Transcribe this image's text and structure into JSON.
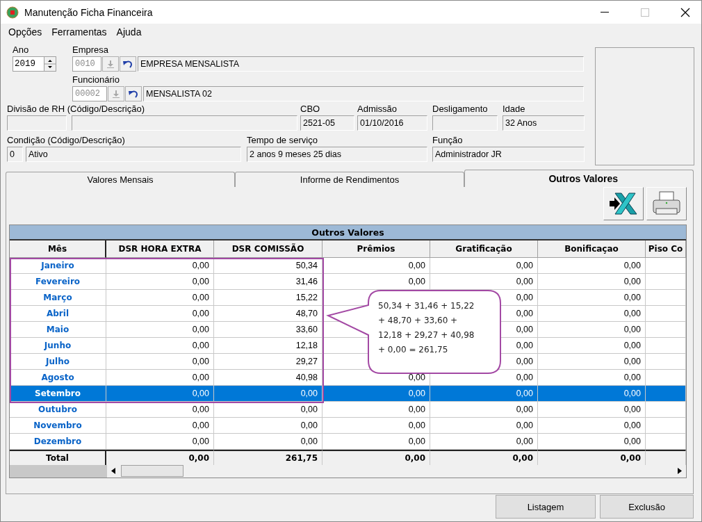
{
  "window": {
    "title": "Manutenção Ficha Financeira"
  },
  "menu": [
    "Opções",
    "Ferramentas",
    "Ajuda"
  ],
  "ano": {
    "label": "Ano",
    "value": "2019"
  },
  "empresa": {
    "label": "Empresa",
    "code": "0010",
    "name": "EMPRESA MENSALISTA"
  },
  "funcionario": {
    "label": "Funcionário",
    "code": "00002",
    "name": "MENSALISTA 02"
  },
  "divisao": {
    "label": "Divisão de RH (Código/Descrição)"
  },
  "cbo": {
    "label": "CBO",
    "value": "2521-05"
  },
  "admissao": {
    "label": "Admissão",
    "value": "01/10/2016"
  },
  "desligamento": {
    "label": "Desligamento"
  },
  "idade": {
    "label": "Idade",
    "value": "32 Anos"
  },
  "condicao": {
    "label": "Condição (Código/Descrição)",
    "code": "0",
    "value": "Ativo"
  },
  "tempo_servico": {
    "label": "Tempo de serviço",
    "value": "2 anos 9 meses 25 dias"
  },
  "funcao": {
    "label": "Função",
    "value": "Administrador JR"
  },
  "tabs": [
    {
      "label": "Valores Mensais",
      "selected": false
    },
    {
      "label": "Informe de Rendimentos",
      "selected": false
    },
    {
      "label": "Outros Valores",
      "selected": true
    }
  ],
  "table": {
    "title": "Outros Valores",
    "columns": [
      "Mês",
      "DSR HORA EXTRA",
      "DSR COMISSÃO",
      "Prêmios",
      "Gratificação",
      "Bonificaçao",
      "Piso Co"
    ],
    "rows": [
      {
        "month": "Janeiro",
        "dsr_hora_extra": "0,00",
        "dsr_comissao": "50,34",
        "premios": "0,00",
        "gratificacao": "0,00",
        "bonificacao": "0,00",
        "selected": false
      },
      {
        "month": "Fevereiro",
        "dsr_hora_extra": "0,00",
        "dsr_comissao": "31,46",
        "premios": "0,00",
        "gratificacao": "0,00",
        "bonificacao": "0,00",
        "selected": false
      },
      {
        "month": "Março",
        "dsr_hora_extra": "0,00",
        "dsr_comissao": "15,22",
        "gratificacao": "0,00",
        "bonificacao": "0,00",
        "selected": false
      },
      {
        "month": "Abril",
        "dsr_hora_extra": "0,00",
        "dsr_comissao": "48,70",
        "gratificacao": "0,00",
        "bonificacao": "0,00",
        "selected": false
      },
      {
        "month": "Maio",
        "dsr_hora_extra": "0,00",
        "dsr_comissao": "33,60",
        "gratificacao": "0,00",
        "bonificacao": "0,00",
        "selected": false
      },
      {
        "month": "Junho",
        "dsr_hora_extra": "0,00",
        "dsr_comissao": "12,18",
        "gratificacao": "0,00",
        "bonificacao": "0,00",
        "selected": false
      },
      {
        "month": "Julho",
        "dsr_hora_extra": "0,00",
        "dsr_comissao": "29,27",
        "gratificacao": "0,00",
        "bonificacao": "0,00",
        "selected": false
      },
      {
        "month": "Agosto",
        "dsr_hora_extra": "0,00",
        "dsr_comissao": "40,98",
        "premios": "0,00",
        "gratificacao": "0,00",
        "bonificacao": "0,00",
        "selected": false
      },
      {
        "month": "Setembro",
        "dsr_hora_extra": "0,00",
        "dsr_comissao": "0,00",
        "premios": "0,00",
        "gratificacao": "0,00",
        "bonificacao": "0,00",
        "selected": true
      },
      {
        "month": "Outubro",
        "dsr_hora_extra": "0,00",
        "dsr_comissao": "0,00",
        "premios": "0,00",
        "gratificacao": "0,00",
        "bonificacao": "0,00",
        "selected": false
      },
      {
        "month": "Novembro",
        "dsr_hora_extra": "0,00",
        "dsr_comissao": "0,00",
        "premios": "0,00",
        "gratificacao": "0,00",
        "bonificacao": "0,00",
        "selected": false
      },
      {
        "month": "Dezembro",
        "dsr_hora_extra": "0,00",
        "dsr_comissao": "0,00",
        "premios": "0,00",
        "gratificacao": "0,00",
        "bonificacao": "0,00",
        "selected": false
      }
    ],
    "total": {
      "label": "Total",
      "dsr_hora_extra": "0,00",
      "dsr_comissao": "261,75",
      "premios": "0,00",
      "gratificacao": "0,00",
      "bonificacao": "0,00"
    }
  },
  "callout": {
    "lines": [
      "50,34 + 31,46 + 15,22",
      "+ 48,70 + 33,60 +",
      "12,18 + 29,27 + 40,98",
      "+ 0,00  = 261,75"
    ]
  },
  "buttons": [
    "Listagem",
    "Exclusão"
  ]
}
